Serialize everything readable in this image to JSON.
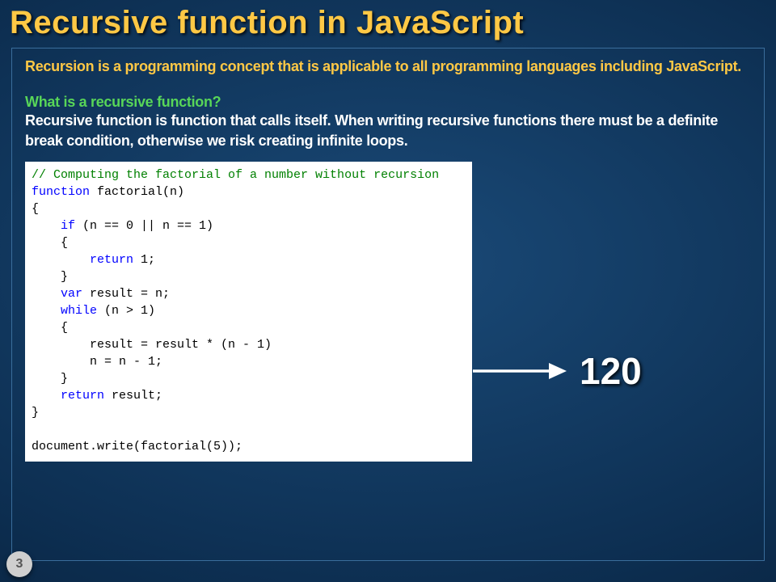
{
  "title": "Recursive function in JavaScript",
  "intro": "Recursion is a programming concept that is applicable to all programming languages including JavaScript.",
  "question": "What is a recursive function?",
  "answer": "Recursive function is function that calls itself. When writing recursive functions there must be a definite break condition, otherwise we risk creating infinite loops.",
  "code": {
    "comment": "// Computing the factorial of a number without recursion",
    "l1a": "function",
    "l1b": " factorial(n)",
    "l2": "{",
    "l3a": "    ",
    "l3b": "if",
    "l3c": " (n == 0 || n == 1)",
    "l4": "    {",
    "l5a": "        ",
    "l5b": "return",
    "l5c": " 1;",
    "l6": "    }",
    "l7a": "    ",
    "l7b": "var",
    "l7c": " result = n;",
    "l8a": "    ",
    "l8b": "while",
    "l8c": " (n > 1)",
    "l9": "    {",
    "l10": "        result = result * (n - 1)",
    "l11": "        n = n - 1;",
    "l12": "    }",
    "l13a": "    ",
    "l13b": "return",
    "l13c": " result;",
    "l14": "}",
    "blank": "",
    "l15": "document.write(factorial(5));"
  },
  "result": "120",
  "pageNumber": "3"
}
